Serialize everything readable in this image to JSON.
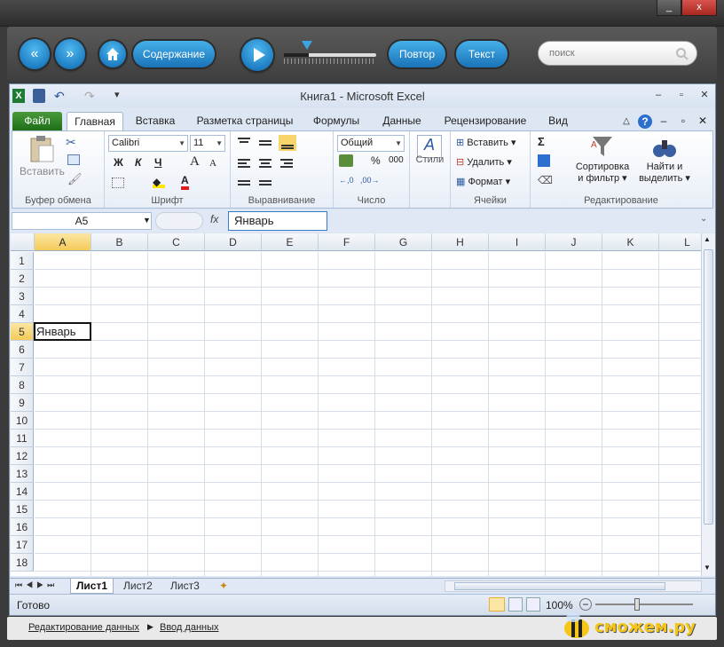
{
  "window": {
    "minimize": "_",
    "close": "x"
  },
  "player": {
    "buttons": {
      "contents": "Содержание",
      "repeat": "Повтор",
      "text": "Текст"
    },
    "search_placeholder": "поиск"
  },
  "excel": {
    "title": "Книга1  -  Microsoft Excel",
    "tabs": [
      "Файл",
      "Главная",
      "Вставка",
      "Разметка страницы",
      "Формулы",
      "Данные",
      "Рецензирование",
      "Вид"
    ],
    "ribbon": {
      "clipboard": {
        "paste": "Вставить",
        "label": "Буфер обмена"
      },
      "font": {
        "name": "Calibri",
        "size": "11",
        "bold": "Ж",
        "italic": "К",
        "underline": "Ч",
        "grow": "A",
        "shrink": "A",
        "label": "Шрифт"
      },
      "align": {
        "label": "Выравнивание"
      },
      "number": {
        "format": "Общий",
        "percent": "%",
        "thousands": "000",
        "label": "Число"
      },
      "styles": {
        "label": "Стили"
      },
      "cells": {
        "insert": "Вставить",
        "delete": "Удалить",
        "format": "Формат",
        "label": "Ячейки"
      },
      "editing": {
        "sort1": "Сортировка",
        "sort2": "и фильтр",
        "find1": "Найти и",
        "find2": "выделить",
        "label": "Редактирование",
        "sum": "Σ"
      }
    },
    "formula_bar": {
      "name_box": "A5",
      "fx": "fx",
      "value": "Январь"
    },
    "columns": [
      "A",
      "B",
      "C",
      "D",
      "E",
      "F",
      "G",
      "H",
      "I",
      "J",
      "K",
      "L"
    ],
    "rows": [
      "1",
      "2",
      "3",
      "4",
      "5",
      "6",
      "7",
      "8",
      "9",
      "10",
      "11",
      "12",
      "13",
      "14",
      "15",
      "16",
      "17",
      "18"
    ],
    "active_cell": {
      "col": "A",
      "row": "5",
      "value": "Январь"
    },
    "sheets": [
      "Лист1",
      "Лист2",
      "Лист3"
    ],
    "status": {
      "ready": "Готово",
      "zoom": "100%"
    }
  },
  "bottom": {
    "link1": "Редактирование данных",
    "link2": "Ввод данных",
    "logo": "сможем.ру"
  }
}
